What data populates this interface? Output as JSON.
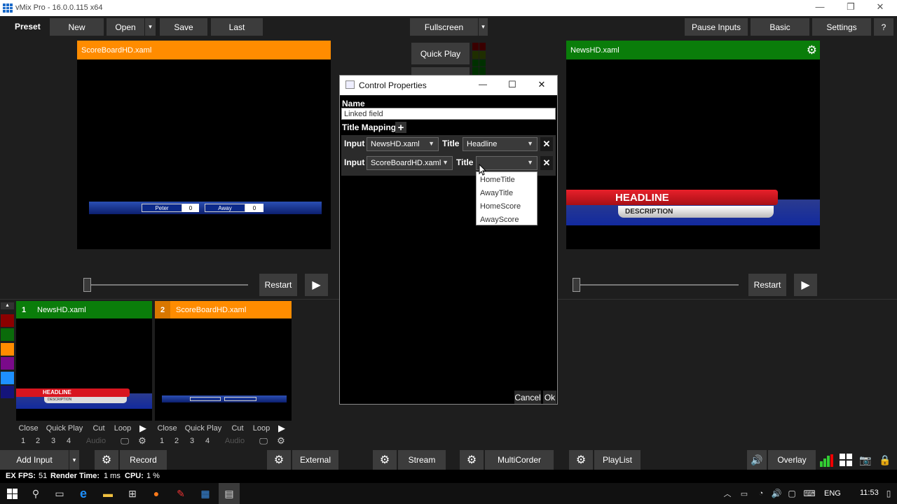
{
  "window": {
    "title": "vMix Pro - 16.0.0.115 x64",
    "minimize": "—",
    "restore": "❐",
    "close": "✕"
  },
  "toolbar": {
    "preset": "Preset",
    "new": "New",
    "open": "Open",
    "save": "Save",
    "last": "Last",
    "fullscreen": "Fullscreen",
    "pause_inputs": "Pause Inputs",
    "basic": "Basic",
    "settings": "Settings",
    "help": "?",
    "dropdown": "▾"
  },
  "preview": {
    "title": "ScoreBoardHD.xaml",
    "color": "#ff8c00",
    "score": {
      "home_label": "Peter",
      "home_value": "0",
      "away_label": "Away",
      "away_value": "0"
    },
    "restart": "Restart",
    "play": "▶"
  },
  "center": {
    "quick_play": "Quick Play"
  },
  "output": {
    "title": "NewsHD.xaml",
    "color": "#0a7d0a",
    "headline": "HEADLINE",
    "description": "DESCRIPTION",
    "restart": "Restart",
    "play": "▶"
  },
  "inputs": [
    {
      "num": "1",
      "name": "NewsHD.xaml",
      "color": "#0a7d0a",
      "num_color": "#0a7d0a",
      "headline": "HEADLINE",
      "description": "DESCRIPTION"
    },
    {
      "num": "2",
      "name": "ScoreBoardHD.xaml",
      "color": "#ff8c00",
      "num_color": "#d97700"
    }
  ],
  "tile_controls": {
    "close": "Close",
    "quick_play": "Quick Play",
    "cut": "Cut",
    "loop": "Loop",
    "play": "▶",
    "n1": "1",
    "n2": "2",
    "n3": "3",
    "n4": "4",
    "audio": "Audio"
  },
  "color_palette": [
    "#8b0000",
    "#0a6b0a",
    "#ff8c00",
    "#7a0a8a",
    "#1e90ff",
    "#14147a"
  ],
  "bottombar": {
    "add_input": "Add Input",
    "record": "Record",
    "external": "External",
    "stream": "Stream",
    "multicorder": "MultiCorder",
    "playlist": "PlayList",
    "overlay": "Overlay"
  },
  "status": {
    "ex": "EX",
    "fps_label": "FPS:",
    "fps": "51",
    "render_label": "Render Time:",
    "render": "1 ms",
    "cpu_label": "CPU:",
    "cpu": "1 %"
  },
  "dialog": {
    "title": "Control Properties",
    "name_label": "Name",
    "name_value": "Linked field",
    "title_mapping_label": "Title Mapping",
    "add": "+",
    "rows": [
      {
        "input_label": "Input",
        "input_value": "NewsHD.xaml",
        "title_label": "Title",
        "title_value": "Headline"
      },
      {
        "input_label": "Input",
        "input_value": "ScoreBoardHD.xaml",
        "title_label": "Title",
        "title_value": ""
      }
    ],
    "dropdown_options": [
      "HomeTitle",
      "AwayTitle",
      "HomeScore",
      "AwayScore"
    ],
    "remove": "✕",
    "cancel": "Cancel",
    "ok": "Ok"
  },
  "taskbar": {
    "language": "ENG",
    "time": "11:53"
  }
}
